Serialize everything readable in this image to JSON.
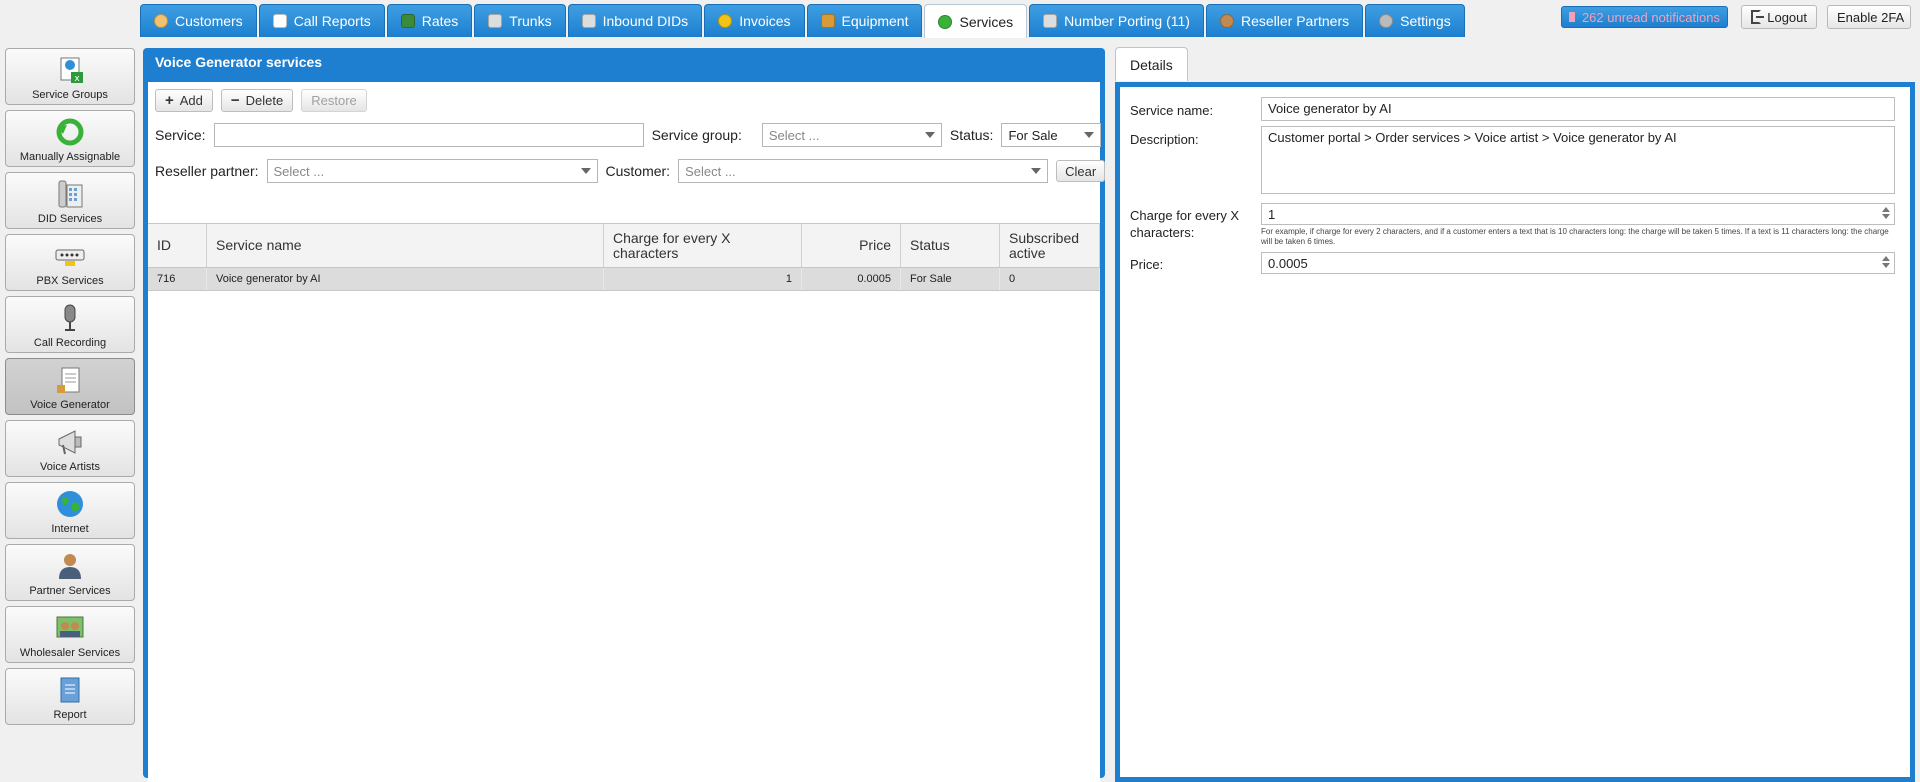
{
  "nav": {
    "tabs": [
      {
        "label": "Customers",
        "icon": "person-icon",
        "color": "#f3c26e"
      },
      {
        "label": "Call Reports",
        "icon": "document-icon",
        "color": "#ffffff"
      },
      {
        "label": "Rates",
        "icon": "chart-icon",
        "color": "#3c8a3c"
      },
      {
        "label": "Trunks",
        "icon": "trunk-icon",
        "color": "#dddddd"
      },
      {
        "label": "Inbound DIDs",
        "icon": "list-icon",
        "color": "#dddddd"
      },
      {
        "label": "Invoices",
        "icon": "coins-icon",
        "color": "#f2c416"
      },
      {
        "label": "Equipment",
        "icon": "box-icon",
        "color": "#d99a3a"
      },
      {
        "label": "Services",
        "icon": "refresh-icon",
        "color": "#3ab23a"
      },
      {
        "label": "Number Porting (11)",
        "icon": "phone-icon",
        "color": "#dddddd"
      },
      {
        "label": "Reseller Partners",
        "icon": "person-icon",
        "color": "#c08a50"
      },
      {
        "label": "Settings",
        "icon": "gears-icon",
        "color": "#bbbbbb"
      }
    ],
    "active_tab": "Services",
    "notifications": "262 unread notifications",
    "logout": "Logout",
    "enable_2fa": "Enable 2FA"
  },
  "sidebar": {
    "items": [
      {
        "label": "Service Groups",
        "icon": "service-groups-icon"
      },
      {
        "label": "Manually Assignable",
        "icon": "recycle-icon"
      },
      {
        "label": "DID Services",
        "icon": "phone-keypad-icon"
      },
      {
        "label": "PBX Services",
        "icon": "pbx-device-icon"
      },
      {
        "label": "Call Recording",
        "icon": "microphone-icon"
      },
      {
        "label": "Voice Generator",
        "icon": "voice-document-icon"
      },
      {
        "label": "Voice Artists",
        "icon": "megaphone-icon"
      },
      {
        "label": "Internet",
        "icon": "globe-icon"
      },
      {
        "label": "Partner Services",
        "icon": "partner-icon"
      },
      {
        "label": "Wholesaler Services",
        "icon": "wholesaler-icon"
      },
      {
        "label": "Report",
        "icon": "report-icon"
      }
    ],
    "active": "Voice Generator"
  },
  "main": {
    "title": "Voice Generator services",
    "toolbar": {
      "add": "Add",
      "delete": "Delete",
      "restore": "Restore"
    },
    "filters": {
      "service_label": "Service:",
      "service_value": "",
      "service_group_label": "Service group:",
      "service_group_placeholder": "Select ...",
      "status_label": "Status:",
      "status_value": "For Sale",
      "reseller_label": "Reseller partner:",
      "reseller_placeholder": "Select ...",
      "customer_label": "Customer:",
      "customer_placeholder": "Select ...",
      "clear": "Clear"
    },
    "table": {
      "columns": [
        "ID",
        "Service name",
        "Charge for every X characters",
        "Price",
        "Status",
        "Subscribed active"
      ],
      "rows": [
        {
          "id": "716",
          "name": "Voice generator by AI",
          "charge": "1",
          "price": "0.0005",
          "status": "For Sale",
          "subscribed": "0"
        }
      ]
    }
  },
  "details": {
    "tab": "Details",
    "service_name_label": "Service name:",
    "service_name": "Voice generator by AI",
    "description_label": "Description:",
    "description": "Customer portal > Order services > Voice artist > Voice generator by AI",
    "charge_label": "Charge for every X characters:",
    "charge_value": "1",
    "charge_hint": "For example, if charge for every 2 characters, and if a customer enters a text that is 10 characters long: the charge will be taken 5 times. If a text is 11 characters long: the charge will be taken 6 times.",
    "price_label": "Price:",
    "price_value": "0.0005"
  }
}
